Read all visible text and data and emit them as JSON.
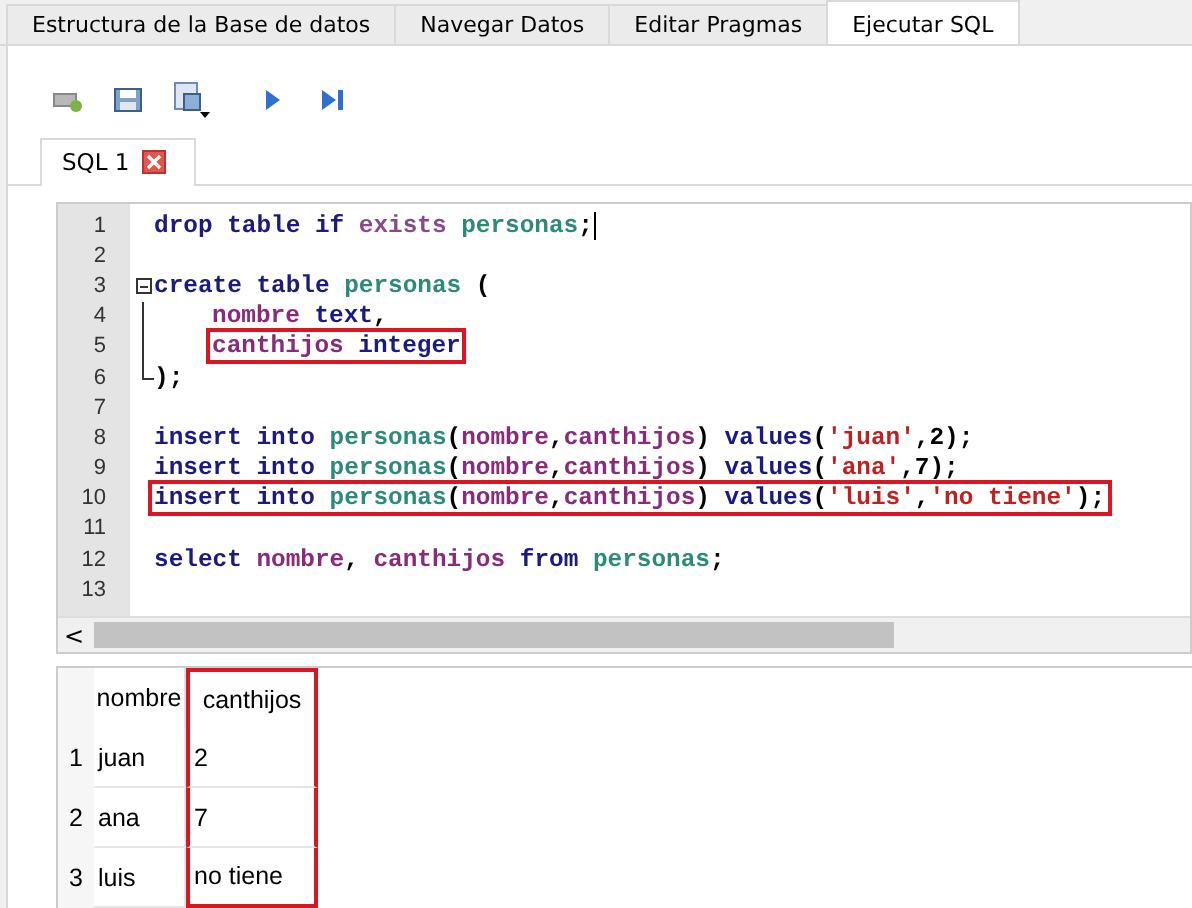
{
  "tabs": [
    {
      "label": "Estructura de la Base de datos",
      "selected": false
    },
    {
      "label": "Navegar Datos",
      "selected": false
    },
    {
      "label": "Editar Pragmas",
      "selected": false
    },
    {
      "label": "Ejecutar SQL",
      "selected": true
    }
  ],
  "toolbar": [
    {
      "kind": "open-tab"
    },
    {
      "kind": "save"
    },
    {
      "kind": "save-menu"
    },
    {
      "kind": "execute"
    },
    {
      "kind": "execute-line"
    }
  ],
  "editor_tabs": [
    {
      "label": "SQL 1",
      "selected": true
    }
  ],
  "editor": {
    "lines": [
      {
        "number": "1",
        "kind": "code",
        "tokens": [
          {
            "kind": "keyword",
            "text": "drop table if "
          },
          {
            "kind": "function",
            "text": "exists "
          },
          {
            "kind": "table",
            "text": "personas"
          },
          {
            "kind": "plain",
            "text": ";"
          }
        ],
        "cursor": true
      },
      {
        "number": "2",
        "kind": "code"
      },
      {
        "number": "3",
        "kind": "fold-start",
        "tokens": [
          {
            "kind": "keyword",
            "text": "create table "
          },
          {
            "kind": "table",
            "text": "personas"
          },
          {
            "kind": "plain",
            "text": " ("
          }
        ]
      },
      {
        "number": "4",
        "kind": "fold-body",
        "tokens": [
          {
            "kind": "column",
            "text": "nombre "
          },
          {
            "kind": "keyword",
            "text": "text"
          },
          {
            "kind": "plain",
            "text": ","
          }
        ]
      },
      {
        "number": "5",
        "kind": "fold-body",
        "highlighted": true,
        "tokens": [
          {
            "kind": "column",
            "text": "canthijos "
          },
          {
            "kind": "keyword",
            "text": "integer"
          }
        ]
      },
      {
        "number": "6",
        "kind": "fold-end",
        "tokens": [
          {
            "kind": "plain",
            "text": ");"
          }
        ]
      },
      {
        "number": "7",
        "kind": "code"
      },
      {
        "number": "8",
        "kind": "code",
        "tokens": [
          {
            "kind": "keyword",
            "text": "insert into "
          },
          {
            "kind": "table",
            "text": "personas"
          },
          {
            "kind": "plain",
            "text": "("
          },
          {
            "kind": "column",
            "text": "nombre"
          },
          {
            "kind": "plain",
            "text": ","
          },
          {
            "kind": "column",
            "text": "canthijos"
          },
          {
            "kind": "plain",
            "text": ") "
          },
          {
            "kind": "keyword",
            "text": "values"
          },
          {
            "kind": "plain",
            "text": "("
          },
          {
            "kind": "string",
            "text": "'juan'"
          },
          {
            "kind": "plain",
            "text": ",2);"
          }
        ]
      },
      {
        "number": "9",
        "kind": "code",
        "tokens": [
          {
            "kind": "keyword",
            "text": "insert into "
          },
          {
            "kind": "table",
            "text": "personas"
          },
          {
            "kind": "plain",
            "text": "("
          },
          {
            "kind": "column",
            "text": "nombre"
          },
          {
            "kind": "plain",
            "text": ","
          },
          {
            "kind": "column",
            "text": "canthijos"
          },
          {
            "kind": "plain",
            "text": ") "
          },
          {
            "kind": "keyword",
            "text": "values"
          },
          {
            "kind": "plain",
            "text": "("
          },
          {
            "kind": "string",
            "text": "'ana'"
          },
          {
            "kind": "plain",
            "text": ",7);"
          }
        ]
      },
      {
        "number": "10",
        "kind": "code",
        "highlighted": true,
        "tokens": [
          {
            "kind": "keyword",
            "text": "insert into "
          },
          {
            "kind": "table",
            "text": "personas"
          },
          {
            "kind": "plain",
            "text": "("
          },
          {
            "kind": "column",
            "text": "nombre"
          },
          {
            "kind": "plain",
            "text": ","
          },
          {
            "kind": "column",
            "text": "canthijos"
          },
          {
            "kind": "plain",
            "text": ") "
          },
          {
            "kind": "keyword",
            "text": "values"
          },
          {
            "kind": "plain",
            "text": "("
          },
          {
            "kind": "string",
            "text": "'luis'"
          },
          {
            "kind": "plain",
            "text": ","
          },
          {
            "kind": "string",
            "text": "'no tiene'"
          },
          {
            "kind": "plain",
            "text": ");"
          }
        ]
      },
      {
        "number": "11",
        "kind": "code"
      },
      {
        "number": "12",
        "kind": "code",
        "tokens": [
          {
            "kind": "keyword",
            "text": "select "
          },
          {
            "kind": "column",
            "text": "nombre"
          },
          {
            "kind": "plain",
            "text": ", "
          },
          {
            "kind": "column",
            "text": "canthijos "
          },
          {
            "kind": "keyword",
            "text": "from "
          },
          {
            "kind": "table",
            "text": "personas"
          },
          {
            "kind": "plain",
            "text": ";"
          }
        ]
      },
      {
        "number": "13",
        "kind": "code"
      }
    ],
    "scroll_left": "<"
  },
  "results": {
    "columns": [
      {
        "label": "nombre",
        "highlighted": false
      },
      {
        "label": "canthijos",
        "highlighted": true
      }
    ],
    "rows": [
      {
        "number": "1",
        "cells": [
          "juan",
          "2"
        ]
      },
      {
        "number": "2",
        "cells": [
          "ana",
          "7"
        ]
      },
      {
        "number": "3",
        "cells": [
          "luis",
          "no tiene"
        ]
      }
    ]
  }
}
